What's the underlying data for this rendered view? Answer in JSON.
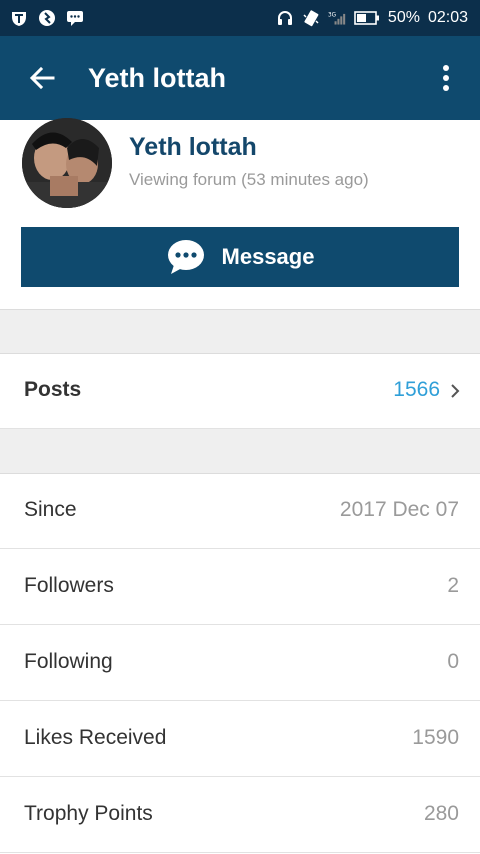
{
  "status_bar": {
    "battery": "50%",
    "time": "02:03",
    "network": "3G"
  },
  "toolbar": {
    "title": "Yeth lottah"
  },
  "profile": {
    "name": "Yeth lottah",
    "status": "Viewing forum (53 minutes ago)",
    "message_label": "Message"
  },
  "posts": {
    "label": "Posts",
    "value": "1566"
  },
  "stats": [
    {
      "label": "Since",
      "value": "2017 Dec 07"
    },
    {
      "label": "Followers",
      "value": "2"
    },
    {
      "label": "Following",
      "value": "0"
    },
    {
      "label": "Likes Received",
      "value": "1590"
    },
    {
      "label": "Trophy Points",
      "value": "280"
    }
  ],
  "colors": {
    "status_bar": "#0c2f4b",
    "toolbar": "#0f4a6e",
    "name": "#14476b",
    "posts_value": "#2f9fd8"
  }
}
